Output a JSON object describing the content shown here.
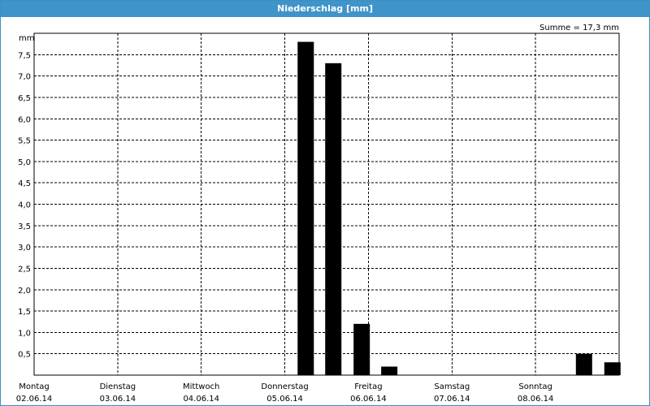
{
  "window": {
    "title": "Niederschlag [mm]"
  },
  "sum_label": "Summe = 17,3 mm",
  "chart_data": {
    "type": "bar",
    "title": "Niederschlag [mm]",
    "ylabel": "mm",
    "xlabel": "",
    "ylim": [
      0,
      8.0
    ],
    "grid": true,
    "y_ticks": [
      "0,5",
      "1,0",
      "1,5",
      "2,0",
      "2,5",
      "3,0",
      "3,5",
      "4,0",
      "4,5",
      "5,0",
      "5,5",
      "6,0",
      "6,5",
      "7,0",
      "7,5"
    ],
    "x_ticks": [
      {
        "day": "Montag",
        "date": "02.06.14"
      },
      {
        "day": "Dienstag",
        "date": "03.06.14"
      },
      {
        "day": "Mittwoch",
        "date": "04.06.14"
      },
      {
        "day": "Donnerstag",
        "date": "05.06.14"
      },
      {
        "day": "Freitag",
        "date": "06.06.14"
      },
      {
        "day": "Samstag",
        "date": "07.06.14"
      },
      {
        "day": "Sonntag",
        "date": "08.06.14"
      }
    ],
    "bars": [
      {
        "day_index": 3.25,
        "value": 7.8
      },
      {
        "day_index": 3.58,
        "value": 7.3
      },
      {
        "day_index": 3.92,
        "value": 1.2
      },
      {
        "day_index": 4.25,
        "value": 0.2
      },
      {
        "day_index": 6.58,
        "value": 0.5
      },
      {
        "day_index": 6.92,
        "value": 0.3
      }
    ],
    "bar_color": "#000000"
  }
}
